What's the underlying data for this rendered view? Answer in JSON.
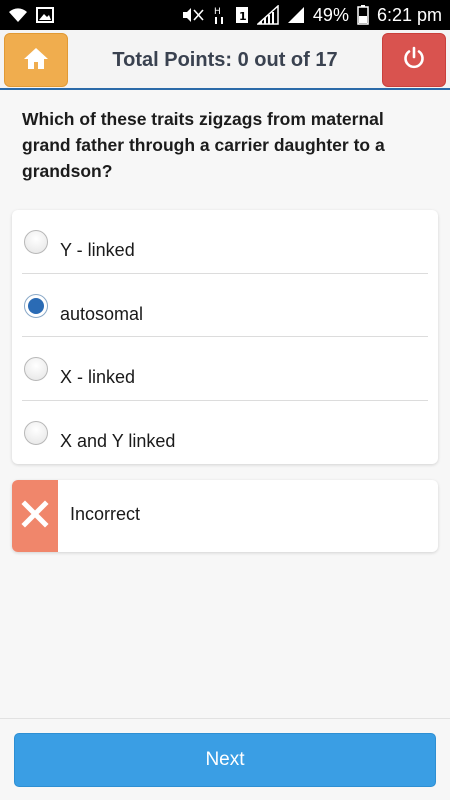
{
  "status_bar": {
    "battery_percent": "49%",
    "time": "6:21 pm",
    "icons": [
      "wifi-icon",
      "image-icon",
      "mute-icon",
      "h-network-icon",
      "sim1-icon",
      "signal-icon",
      "signal2-icon",
      "battery-icon"
    ]
  },
  "header": {
    "title": "Total Points: 0 out of 17",
    "home_icon": "home-icon",
    "power_icon": "power-icon",
    "colors": {
      "home": "#f0ad4e",
      "power": "#d9534f",
      "accent": "#2b6aa8"
    }
  },
  "question": {
    "text": "Which of these traits zigzags from maternal grand father through a carrier daughter to  a grandson?"
  },
  "options": [
    {
      "label": "Y - linked",
      "selected": false
    },
    {
      "label": "autosomal",
      "selected": true
    },
    {
      "label": "X - linked",
      "selected": false
    },
    {
      "label": "X and Y linked",
      "selected": false
    }
  ],
  "result": {
    "text": "Incorrect",
    "icon": "cross-icon",
    "color": "#f0866b"
  },
  "footer": {
    "next_label": "Next",
    "color": "#3a9ee4"
  }
}
